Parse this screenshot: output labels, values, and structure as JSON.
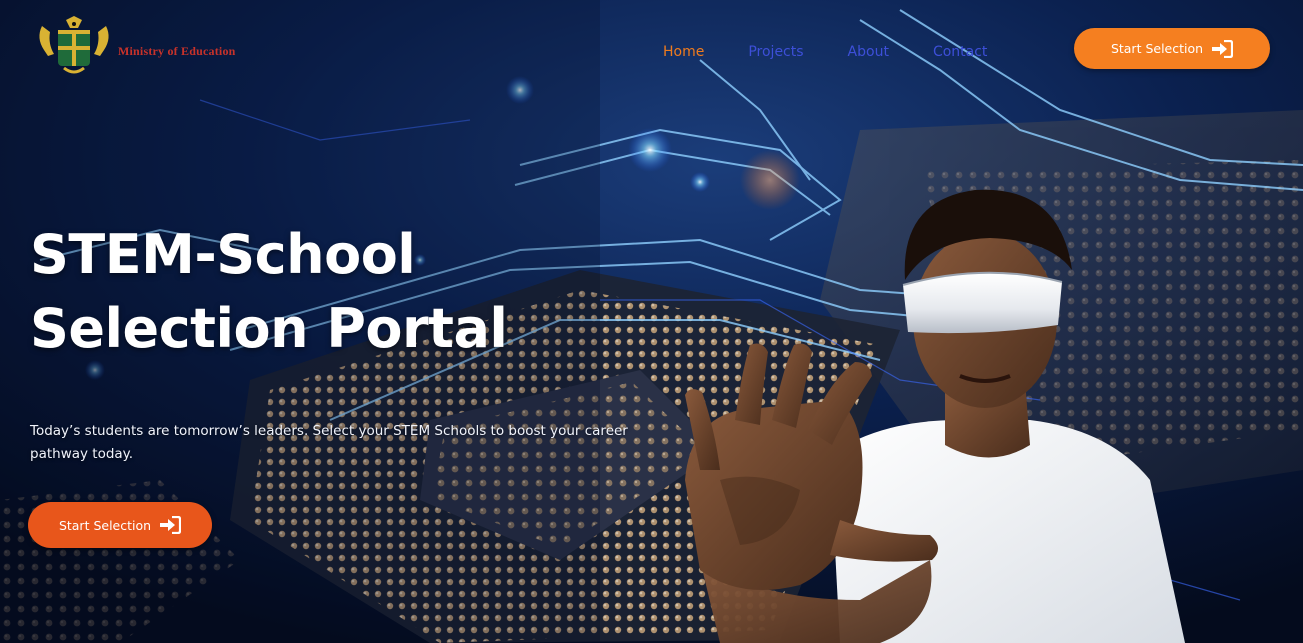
{
  "header": {
    "brand_name": "Ministry of Education",
    "logo_icon": "ghana-coat-of-arms-icon",
    "nav_items": [
      {
        "label": "Home",
        "active": true
      },
      {
        "label": "Projects",
        "active": false
      },
      {
        "label": "About",
        "active": false
      },
      {
        "label": "Contact",
        "active": false
      }
    ],
    "cta_label": "Start Selection",
    "cta_icon": "sign-in-icon"
  },
  "hero": {
    "title_line1": "STEM-School",
    "title_line2": "Selection Portal",
    "subtitle": "Today’s students are tomorrow’s leaders. Select your STEM Schools to boost your career pathway today.",
    "cta_label": "Start Selection",
    "cta_icon": "sign-in-icon",
    "image": "student-wearing-vr-headset-with-raised-hand-over-circuit-board-background"
  },
  "colors": {
    "accent_orange": "#f57f20",
    "nav_link_blue": "#3d4fd8",
    "nav_active_orange": "#f07b1d",
    "background_navy": "#06122b"
  }
}
